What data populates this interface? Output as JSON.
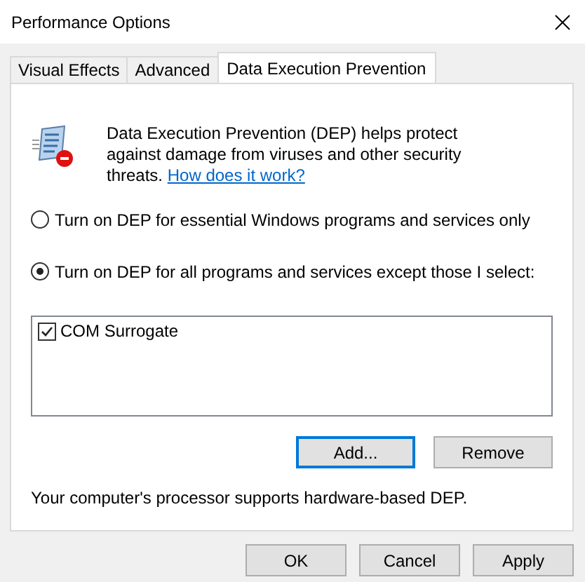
{
  "window": {
    "title": "Performance Options"
  },
  "tabs": [
    {
      "label": "Visual Effects",
      "selected": false
    },
    {
      "label": "Advanced",
      "selected": false
    },
    {
      "label": "Data Execution Prevention",
      "selected": true
    }
  ],
  "description": {
    "text": "Data Execution Prevention (DEP) helps protect against damage from viruses and other security threats.",
    "link": "How does it work?"
  },
  "options": [
    {
      "label": "Turn on DEP for essential Windows programs and services only",
      "selected": false
    },
    {
      "label": "Turn on DEP for all programs and services except those I select:",
      "selected": true
    }
  ],
  "exceptions": [
    {
      "label": "COM Surrogate",
      "checked": true
    }
  ],
  "list_buttons": [
    {
      "label": "Add...",
      "focused": true
    },
    {
      "label": "Remove",
      "focused": false
    }
  ],
  "status": "Your computer's processor supports hardware-based DEP.",
  "dialog_buttons": [
    {
      "label": "OK"
    },
    {
      "label": "Cancel"
    },
    {
      "label": "Apply"
    }
  ]
}
